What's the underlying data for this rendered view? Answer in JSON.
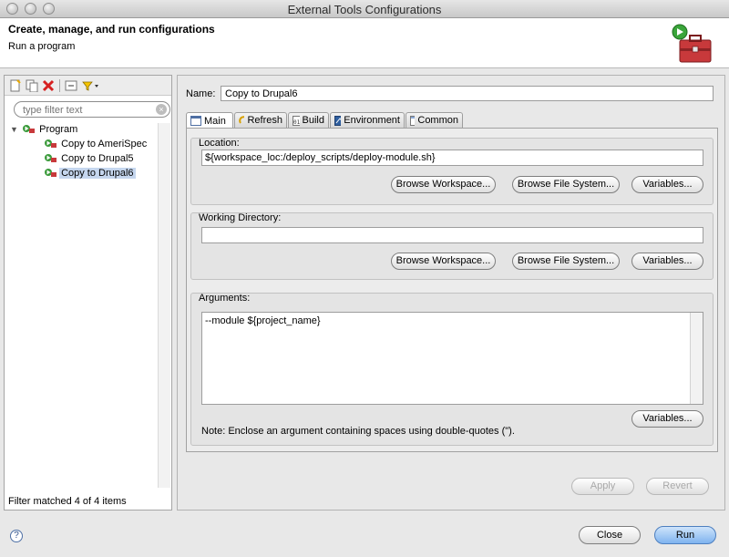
{
  "window": {
    "title": "External Tools Configurations"
  },
  "header": {
    "title": "Create, manage, and run configurations",
    "subtitle": "Run a program"
  },
  "sidebar": {
    "filter_placeholder": "type filter text",
    "tree": {
      "root": "Program",
      "items": [
        "Copy to AmeriSpec",
        "Copy to Drupal5",
        "Copy to Drupal6"
      ],
      "selected": "Copy to Drupal6"
    },
    "status": "Filter matched 4 of 4 items"
  },
  "config": {
    "name_label": "Name:",
    "name_value": "Copy to Drupal6",
    "tabs": [
      "Main",
      "Refresh",
      "Build",
      "Environment",
      "Common"
    ],
    "active_tab": "Main",
    "location": {
      "label": "Location:",
      "value": "${workspace_loc:/deploy_scripts/deploy-module.sh}"
    },
    "working_dir": {
      "label": "Working Directory:",
      "value": ""
    },
    "arguments": {
      "label": "Arguments:",
      "value": "--module ${project_name}",
      "note": "Note: Enclose an argument containing spaces using double-quotes (\")."
    },
    "buttons": {
      "browse_workspace": "Browse Workspace...",
      "browse_file_system": "Browse File System...",
      "variables": "Variables..."
    },
    "apply": "Apply",
    "revert": "Revert"
  },
  "footer": {
    "help": "?",
    "close": "Close",
    "run": "Run"
  },
  "colors": {
    "selection": "#c5d6ee",
    "run_button": "#7fb3ef",
    "error_red": "#d62020",
    "program_green": "#3a9a3a"
  }
}
